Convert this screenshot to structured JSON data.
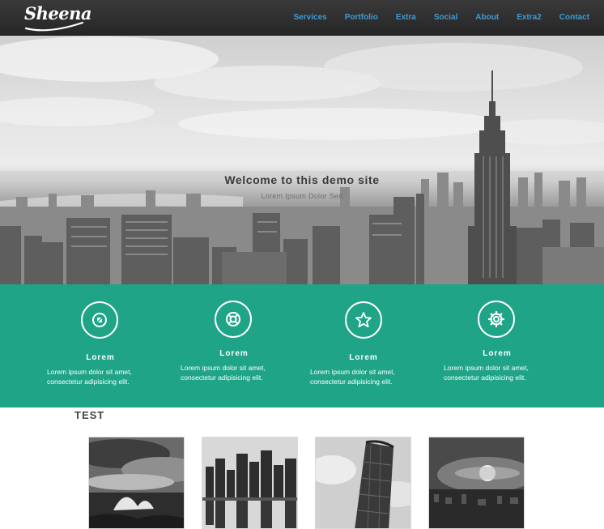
{
  "brand": {
    "logo_text": "Sheena"
  },
  "nav": {
    "items": [
      {
        "label": "Services"
      },
      {
        "label": "Portfolio"
      },
      {
        "label": "Extra"
      },
      {
        "label": "Social"
      },
      {
        "label": "About"
      },
      {
        "label": "Extra2"
      },
      {
        "label": "Contact"
      }
    ],
    "link_color": "#3d9bd6"
  },
  "hero": {
    "title": "Welcome to this demo site",
    "subtitle": "Lorem Ipsum Dolor Sed"
  },
  "features": {
    "background_color": "#1fa487",
    "items": [
      {
        "icon": "sync-arrows-icon",
        "title": "Lorem",
        "text_line1": "Lorem ipsum dolor sit amet,",
        "text_line2": "consectetur adipisicing elit."
      },
      {
        "icon": "lifebuoy-icon",
        "title": "Lorem",
        "text_line1": "Lorem ipsum dolor sit amet,",
        "text_line2": "consectetur adipisicing elit."
      },
      {
        "icon": "star-icon",
        "title": "Lorem",
        "text_line1": "Lorem ipsum dolor sit amet,",
        "text_line2": "consectetur adipisicing elit."
      },
      {
        "icon": "gear-icon",
        "title": "Lorem",
        "text_line1": "Lorem ipsum dolor sit amet,",
        "text_line2": "consectetur adipisicing elit."
      }
    ]
  },
  "gallery": {
    "title": "TEST",
    "thumbnails": [
      {
        "subject": "stormy-sea-photo"
      },
      {
        "subject": "city-reflection-photo"
      },
      {
        "subject": "glass-tower-photo"
      },
      {
        "subject": "city-sunburst-photo"
      }
    ]
  }
}
